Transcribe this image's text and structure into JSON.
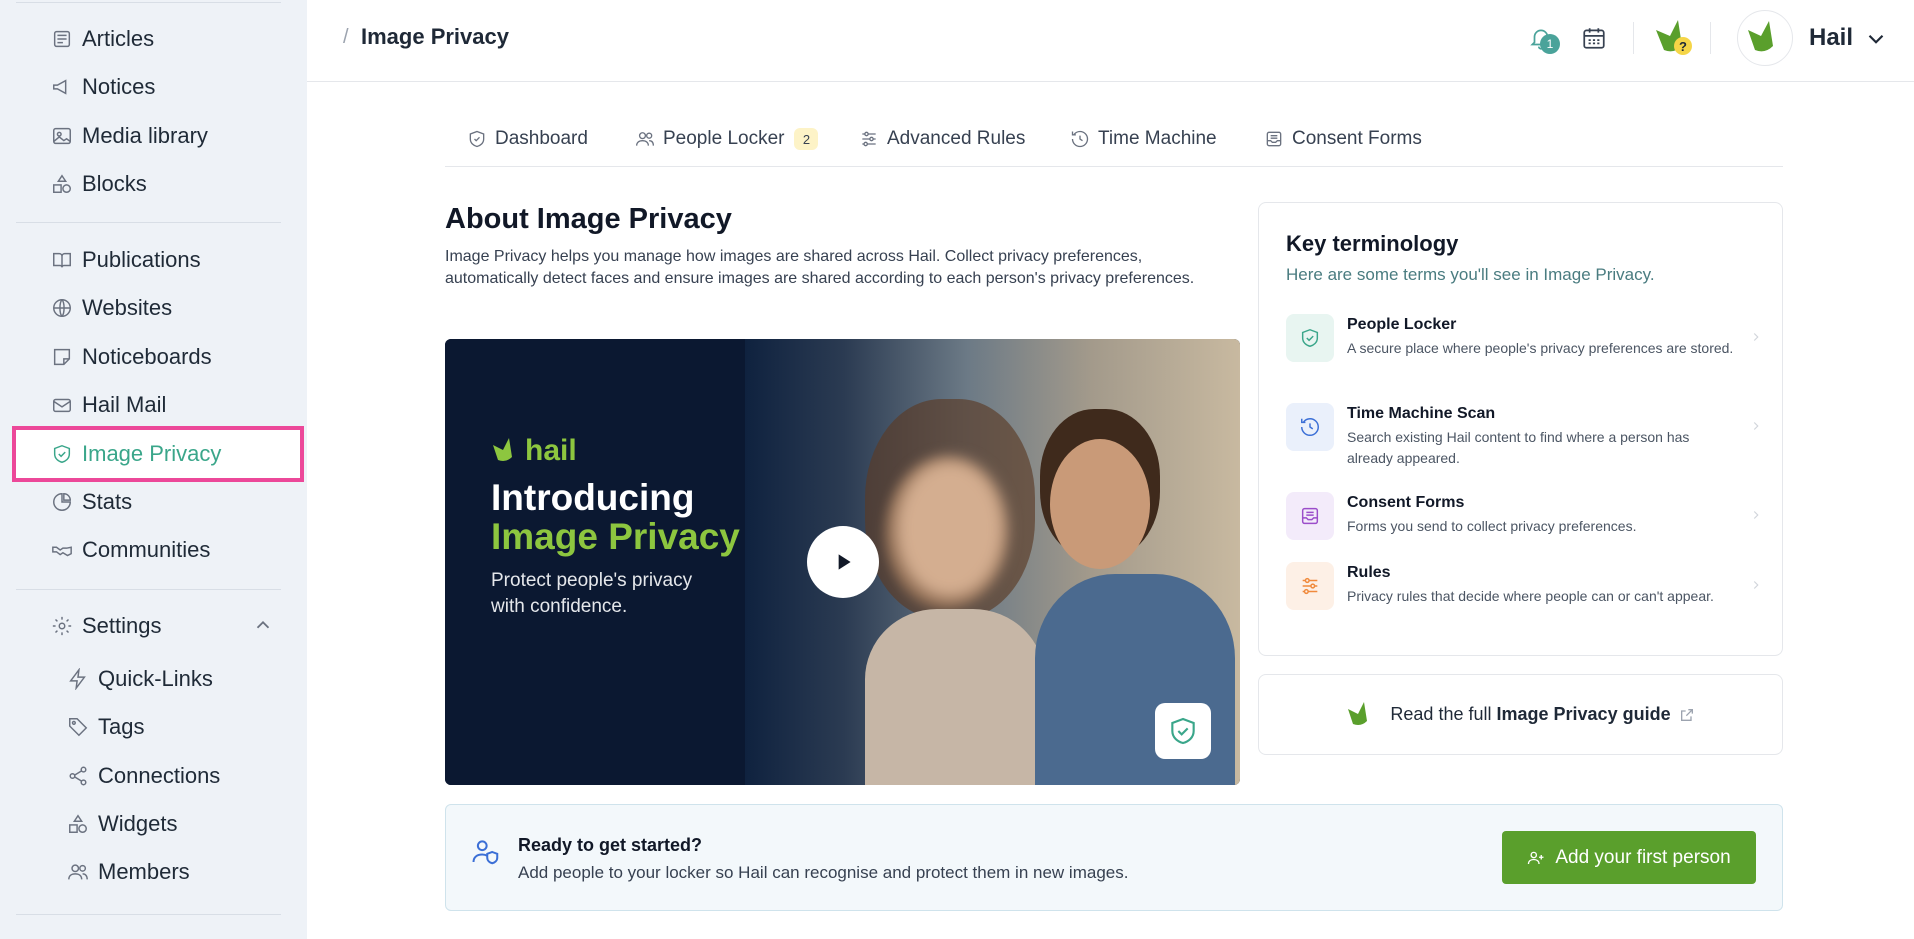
{
  "sidebar": {
    "items": [
      {
        "label": "Articles",
        "icon": "newspaper-icon"
      },
      {
        "label": "Notices",
        "icon": "megaphone-icon"
      },
      {
        "label": "Media library",
        "icon": "image-icon"
      },
      {
        "label": "Blocks",
        "icon": "shapes-icon"
      },
      {
        "label": "Publications",
        "icon": "book-open-icon"
      },
      {
        "label": "Websites",
        "icon": "globe-icon"
      },
      {
        "label": "Noticeboards",
        "icon": "sticky-note-icon"
      },
      {
        "label": "Hail Mail",
        "icon": "mail-icon"
      },
      {
        "label": "Image Privacy",
        "icon": "shield-check-icon",
        "active": true
      },
      {
        "label": "Stats",
        "icon": "pie-chart-icon"
      },
      {
        "label": "Communities",
        "icon": "handshake-icon"
      },
      {
        "label": "Settings",
        "icon": "gear-icon",
        "expanded": true
      }
    ],
    "settings_items": [
      {
        "label": "Quick-Links",
        "icon": "lightning-icon"
      },
      {
        "label": "Tags",
        "icon": "tag-icon"
      },
      {
        "label": "Connections",
        "icon": "share-icon"
      },
      {
        "label": "Widgets",
        "icon": "shapes-icon"
      },
      {
        "label": "Members",
        "icon": "users-icon"
      }
    ],
    "active_color": "#3aa68a",
    "highlight_color": "#ec4899"
  },
  "header": {
    "breadcrumb_sep": "/",
    "title": "Image Privacy",
    "notification_count": "1",
    "user_name": "Hail"
  },
  "tabs": [
    {
      "label": "Dashboard",
      "icon": "shield-icon"
    },
    {
      "label": "People Locker",
      "icon": "users-icon",
      "badge": "2"
    },
    {
      "label": "Advanced Rules",
      "icon": "sliders-icon"
    },
    {
      "label": "Time Machine",
      "icon": "history-icon"
    },
    {
      "label": "Consent Forms",
      "icon": "inbox-icon"
    }
  ],
  "about": {
    "title": "About Image Privacy",
    "text": "Image Privacy helps you manage how images are shared across Hail. Collect privacy preferences, automatically detect faces and ensure images are shared according to each person's privacy preferences."
  },
  "video": {
    "brand": "hail",
    "line1": "Introducing",
    "line2": "Image Privacy",
    "subtitle": "Protect people's privacy with confidence.",
    "accent": "#8dc63f"
  },
  "terminology": {
    "title": "Key terminology",
    "subtitle": "Here are some terms you'll see in Image Privacy.",
    "terms": [
      {
        "name": "People Locker",
        "desc": "A secure place where people's privacy preferences are stored.",
        "icon": "shield-check-icon",
        "color": "#3aa68a"
      },
      {
        "name": "Time Machine Scan",
        "desc": "Search existing Hail content to find where a person has already appeared.",
        "icon": "history-icon",
        "color": "#3b6fd6"
      },
      {
        "name": "Consent Forms",
        "desc": "Forms you send to collect privacy preferences.",
        "icon": "inbox-icon",
        "color": "#9b4dca"
      },
      {
        "name": "Rules",
        "desc": "Privacy rules that decide where people can or can't appear.",
        "icon": "sliders-icon",
        "color": "#f08a3c"
      }
    ]
  },
  "guide": {
    "prefix": "Read the full",
    "bold": "Image Privacy guide"
  },
  "ready": {
    "title": "Ready to get started?",
    "text": "Add people to your locker so Hail can recognise and protect them in new images.",
    "button": "Add your first person",
    "button_color": "#5a9f2c"
  }
}
